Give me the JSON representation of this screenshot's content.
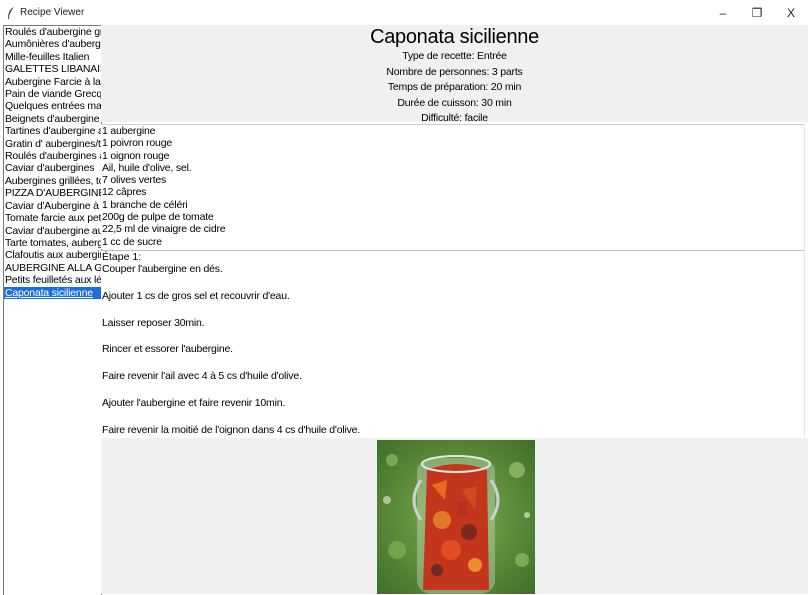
{
  "window": {
    "title": "Recipe Viewer",
    "controls": {
      "minimize": "–",
      "restore": "❐",
      "close": "X"
    }
  },
  "recipe_list": [
    "Roulés d'aubergine grillée",
    "Aumônières d'aubergines",
    "Mille-feuilles Italien",
    "GALETTES LIBANAISES",
    "Aubergine Farcie à la Gre",
    "Pain de viande Grecque S",
    "Quelques entrées maroca",
    "Beignets d'aubergine",
    "Tartines d'aubergine au co",
    "Gratin d' aubergines/toma",
    "Roulés d'aubergines au ja",
    "Caviar d'aubergines",
    "Aubergines grillées, tomat",
    "PIZZA D'AUBERGINE",
    "Caviar d'Aubergine à l'Asi",
    "Tomate farcie aux petits lé",
    "Caviar d'aubergine au fron",
    "Tarte tomates, aubergines",
    "Clafoutis aux aubergines d",
    "AUBERGINE ALLA GENC",
    "Petits feuilletés aux légum",
    "Caponata sicilienne"
  ],
  "selected_index": 21,
  "recipe": {
    "title": "Caponata sicilienne",
    "type": "Type de recette: Entrée",
    "servings": "Nombre de personnes: 3 parts",
    "prep_time": "Temps de préparation: 20 min",
    "cook_time": "Durée de cuisson: 30 min",
    "difficulty": "Difficulté: facile",
    "ingredients": [
      "1 aubergine",
      "1 poivron rouge",
      "1 oignon rouge",
      "Ail, huile d'olive, sel.",
      "7 olives vertes",
      "12 câpres",
      "1 branche de céléri",
      "200g de pulpe de tomate",
      "22,5 ml de vinaigre de cidre",
      "1 cc de sucre"
    ],
    "step_heading": "Étape 1:",
    "steps": [
      "Couper l'aubergine en dés.",
      "Ajouter 1 cs de gros sel et recouvrir d'eau.",
      "Laisser reposer 30min.",
      "Rincer et essorer l'aubergine.",
      "Faire revenir l'ail avec 4 à 5 cs d'huile d'olive.",
      "Ajouter l'aubergine et faire revenir 10min.",
      "Faire revenir la moitié de l'oignon dans 4 cs d'huile d'olive."
    ]
  },
  "colors": {
    "selection": "#1a6fdc",
    "panel_bg": "#f0f0f0",
    "photo_grass": "#5a8a3a",
    "photo_sauce": "#c4361c"
  }
}
